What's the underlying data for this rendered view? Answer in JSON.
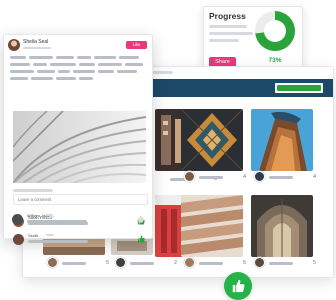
{
  "progress": {
    "title": "Progress",
    "percent": 73,
    "percent_label": "73%",
    "share_label": "Share",
    "accent": "#2aa43a",
    "button_color": "#e8397c"
  },
  "post": {
    "author": "Sheila Seal",
    "like_label": "Like",
    "comment_placeholder": "Leave a comment",
    "comments": [
      {
        "name": "Sarah Forbes"
      },
      {
        "name": "Ssoth"
      },
      {
        "name": "William Jails"
      }
    ],
    "thumb_color": "#2aa43a"
  },
  "gallery": {
    "toolbar_color": "#1c4968",
    "tiles": [
      {
        "likes": "5"
      },
      {
        "likes": "4"
      },
      {
        "likes": "4"
      },
      {
        "likes": "5"
      },
      {
        "likes": "2"
      },
      {
        "likes": "5"
      },
      {
        "likes": "5"
      },
      {
        "likes": "4"
      }
    ]
  },
  "icons": {
    "like_badge": "thumbs-up-icon",
    "comment_like": "thumbs-up-icon",
    "tile_like": "heart-icon"
  }
}
